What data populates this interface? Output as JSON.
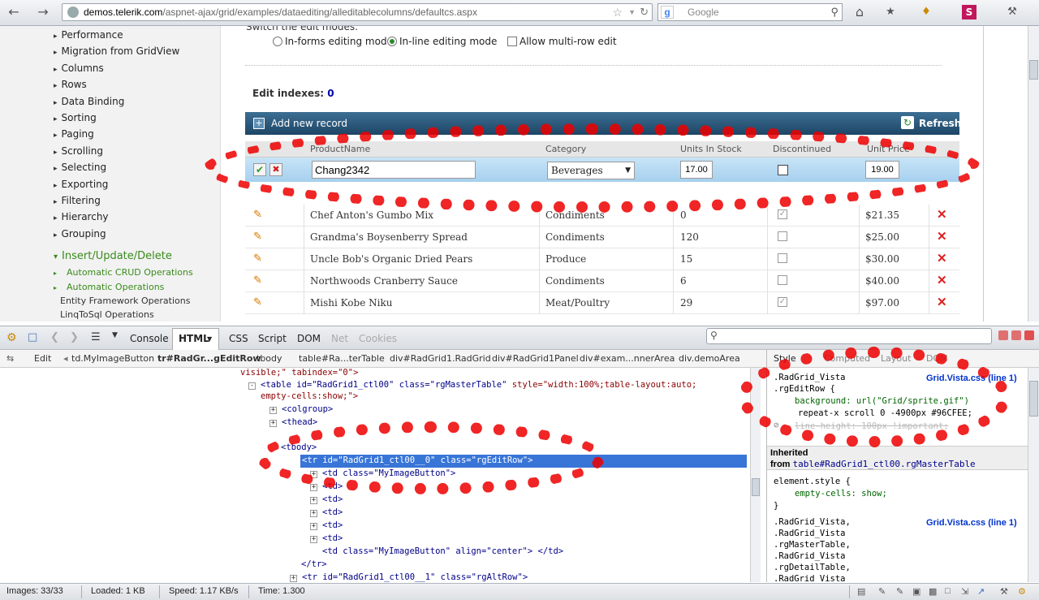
{
  "browser": {
    "url_host": "demos.telerik.com",
    "url_path": "/aspnet-ajax/grid/examples/dataediting/alleditablecolumns/defaultcs.aspx",
    "search_placeholder": "Google",
    "google_label": "g"
  },
  "sidebar": {
    "items": [
      "Performance",
      "Migration from GridView",
      "Columns",
      "Rows",
      "Data Binding",
      "Sorting",
      "Paging",
      "Scrolling",
      "Selecting",
      "Exporting",
      "Filtering",
      "Hierarchy",
      "Grouping"
    ],
    "section": "Insert/Update/Delete",
    "subitems": [
      "Automatic CRUD Operations",
      "Automatic Operations",
      "Entity Framework Operations",
      "LinqToSql Operations"
    ]
  },
  "main": {
    "switch_label": "Switch the edit modes:",
    "mode_informs": "In-forms editing mode",
    "mode_inline": "In-line editing mode",
    "multirow": "Allow multi-row edit",
    "edit_indexes_label": "Edit indexes:",
    "edit_indexes_value": "0",
    "add_record": "Add new record",
    "refresh": "Refresh",
    "columns": [
      "ProductName",
      "Category",
      "Units In Stock",
      "Discontinued",
      "Unit Price"
    ],
    "edit_row": {
      "name": "Chang2342",
      "category": "Beverages",
      "units": "17.00",
      "price": "19.00"
    },
    "rows": [
      {
        "name": "Chef Anton's Gumbo Mix",
        "category": "Condiments",
        "units": "0",
        "discontinued": true,
        "price": "$21.35"
      },
      {
        "name": "Grandma's Boysenberry Spread",
        "category": "Condiments",
        "units": "120",
        "discontinued": false,
        "price": "$25.00"
      },
      {
        "name": "Uncle Bob's Organic Dried Pears",
        "category": "Produce",
        "units": "15",
        "discontinued": false,
        "price": "$30.00"
      },
      {
        "name": "Northwoods Cranberry Sauce",
        "category": "Condiments",
        "units": "6",
        "discontinued": false,
        "price": "$40.00"
      },
      {
        "name": "Mishi Kobe Niku",
        "category": "Meat/Poultry",
        "units": "29",
        "discontinued": true,
        "price": "$97.00"
      }
    ]
  },
  "firebug": {
    "tabs": {
      "console": "Console",
      "html": "HTML",
      "css": "CSS",
      "script": "Script",
      "dom": "DOM",
      "net": "Net",
      "cookies": "Cookies"
    },
    "crumbs": [
      "Edit",
      "td.MyImageButton",
      "tr#RadGr...gEditRow",
      "tbody",
      "table#Ra...terTable",
      "div#RadGrid1.RadGrid",
      "div#RadGrid1Panel",
      "div#exam...nnerArea",
      "div.demoArea"
    ],
    "style_tabs": [
      "Style",
      "Computed",
      "Layout",
      "DOM"
    ],
    "html_lines": {
      "l0": "visible;\" tabindex=\"0\">",
      "l1_tag": "<table",
      "l1_id": "id=\"RadGrid1_ctl00\"",
      "l1_class": "class=\"rgMasterTable\"",
      "l1_style": "style=\"width:100%;table-layout:auto;",
      "l2": "empty-cells:show;\">",
      "l3": "<colgroup>",
      "l4": "<thead>",
      "l5": "<tbody>",
      "l6": "<tr id=\"RadGrid1_ctl00__0\" class=\"rgEditRow\">",
      "l7": "<td class=\"MyImageButton\">",
      "l8": "<td>",
      "l9": "<td>",
      "l10": "<td>",
      "l11": "<td>",
      "l12": "<td>",
      "l13": "<td class=\"MyImageButton\" align=\"center\"> </td>",
      "l14": "</tr>",
      "l15": "<tr id=\"RadGrid1_ctl00__1\" class=\"rgAltRow\">"
    },
    "style_lines": {
      "s1": ".RadGrid_Vista",
      "s1_link": "Grid.Vista.css (line 1)",
      "s2": ".rgEditRow {",
      "s3": "background: url(\"Grid/sprite.gif\")",
      "s4": "repeat-x scroll 0 -4900px #96CFEE;",
      "s5": "line-height: 100px !important;",
      "inherited": "Inherited",
      "from": "from",
      "from_link": "table#RadGrid1_ctl00.rgMasterTable",
      "s6": "element.style {",
      "s7": "empty-cells: show;",
      "s8": "}",
      "s9": ".RadGrid_Vista,",
      "s9_link": "Grid.Vista.css (line 1)",
      "s10": ".RadGrid_Vista",
      "s11": ".rgMasterTable,",
      "s12": ".RadGrid_Vista",
      "s13": ".rgDetailTable,",
      "s14": ".RadGrid_Vista"
    }
  },
  "statusbar": {
    "images": "Images: 33/33",
    "loaded": "Loaded: 1 KB",
    "speed": "Speed: 1.17 KB/s",
    "time": "Time: 1.300"
  }
}
